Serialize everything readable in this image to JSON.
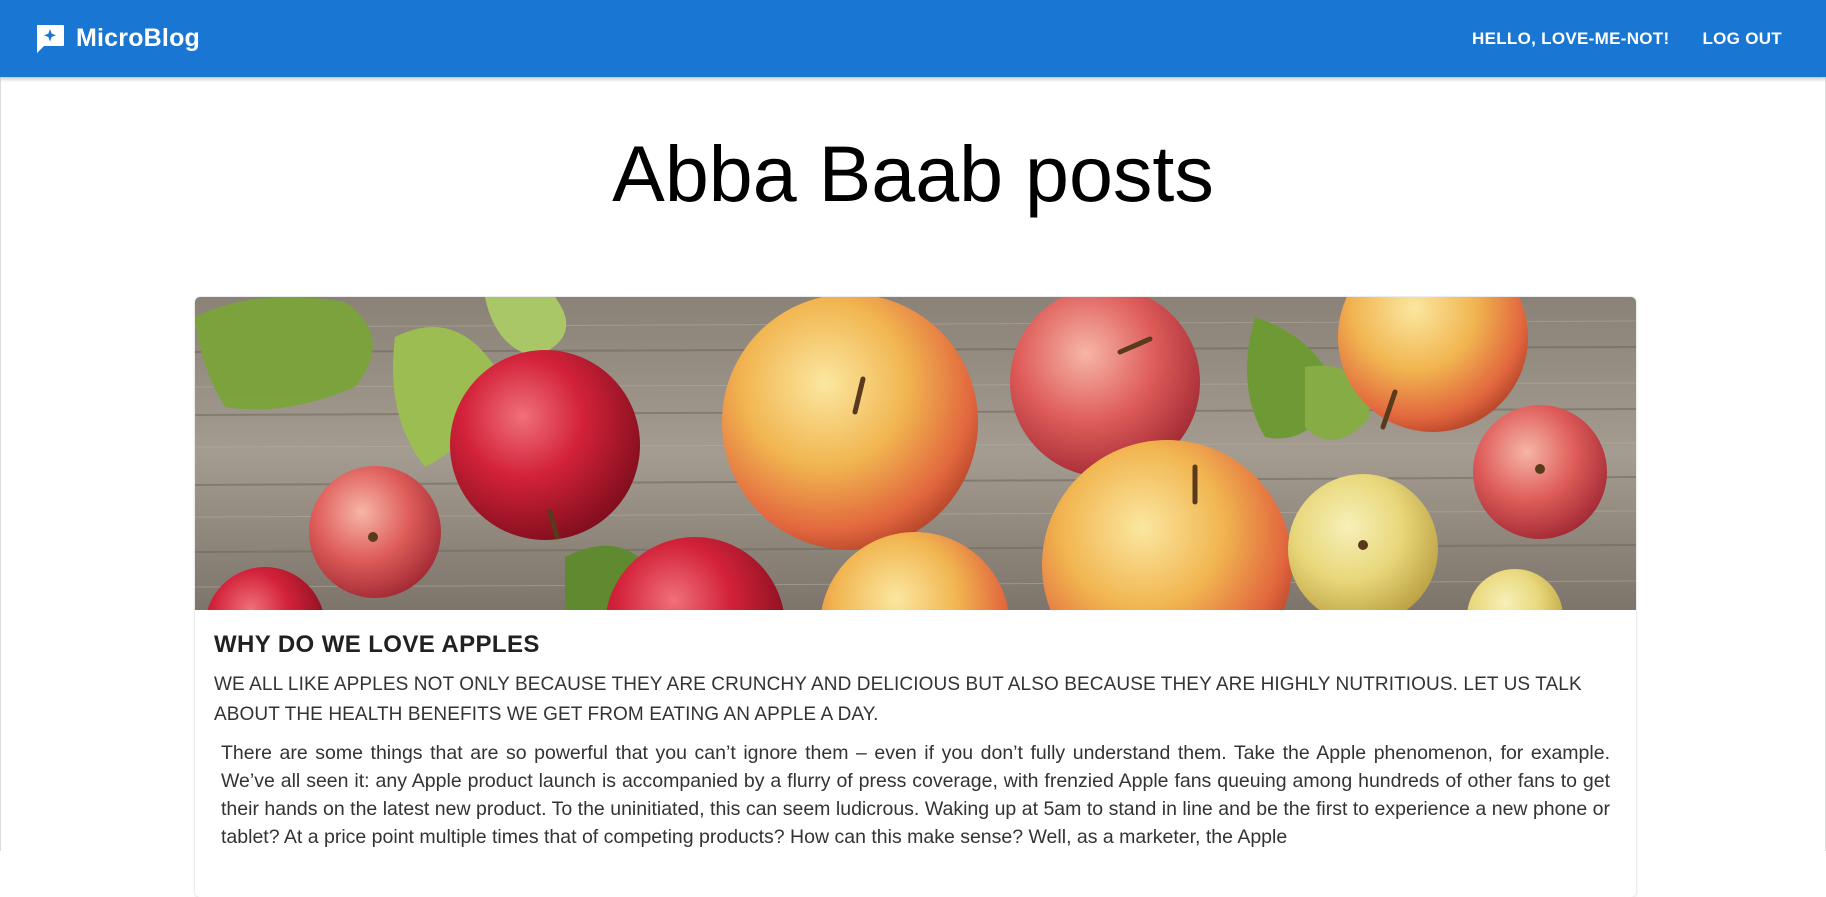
{
  "navbar": {
    "brand_name": "MicroBlog",
    "brand_icon": "chat-sparkle-icon",
    "greeting": "HELLO, LOVE-ME-NOT!",
    "logout_label": "LOG OUT",
    "background_color": "#1976d2"
  },
  "page": {
    "title": "Abba Baab posts"
  },
  "post": {
    "image": "apples-on-wooden-table",
    "title": "WHY DO WE LOVE APPLES",
    "subtitle": "WE ALL LIKE APPLES NOT ONLY BECAUSE THEY ARE CRUNCHY AND DELICIOUS BUT ALSO BECAUSE THEY ARE HIGHLY NUTRITIOUS. LET US TALK ABOUT THE HEALTH BENEFITS WE GET FROM EATING AN APPLE A DAY.",
    "body": "There are some things that are so powerful that you can’t ignore them – even if you don’t fully understand them. Take the Apple phenomenon, for example. We’ve all seen it: any Apple product launch is accompanied by a flurry of press coverage, with frenzied Apple fans queuing among hundreds of other fans to get their hands on the latest new product. To the uninitiated, this can seem ludicrous. Waking up at 5am to stand in line and be the first to experience a new phone or tablet? At a price point multiple times that of competing products? How can this make sense? Well, as a marketer, the Apple"
  }
}
